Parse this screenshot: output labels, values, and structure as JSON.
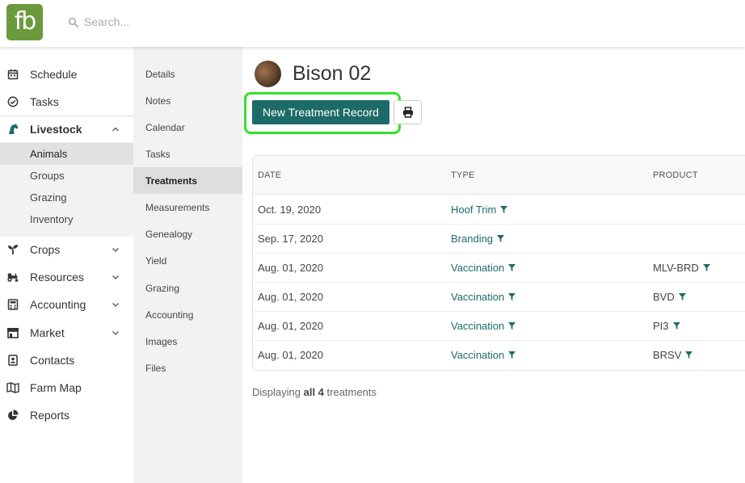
{
  "brand": {
    "logo_text": "fb",
    "color": "#6a9a3c"
  },
  "search": {
    "placeholder": "Search..."
  },
  "sidebar": {
    "items": [
      {
        "label": "Schedule",
        "icon": "calendar-icon"
      },
      {
        "label": "Tasks",
        "icon": "check-circle-icon"
      },
      {
        "label": "Livestock",
        "icon": "horse-icon",
        "expanded": true
      },
      {
        "label": "Crops",
        "icon": "seedling-icon"
      },
      {
        "label": "Resources",
        "icon": "tractor-icon"
      },
      {
        "label": "Accounting",
        "icon": "calculator-icon"
      },
      {
        "label": "Market",
        "icon": "store-icon"
      },
      {
        "label": "Contacts",
        "icon": "address-book-icon"
      },
      {
        "label": "Farm Map",
        "icon": "map-icon"
      },
      {
        "label": "Reports",
        "icon": "pie-chart-icon"
      }
    ],
    "livestock_sub": [
      "Animals",
      "Groups",
      "Grazing",
      "Inventory"
    ],
    "active_sub": "Animals"
  },
  "subnav": {
    "items": [
      "Details",
      "Notes",
      "Calendar",
      "Tasks",
      "Treatments",
      "Measurements",
      "Genealogy",
      "Yield",
      "Grazing",
      "Accounting",
      "Images",
      "Files"
    ],
    "active": "Treatments"
  },
  "animal": {
    "name": "Bison 02"
  },
  "actions": {
    "new_record_label": "New Treatment Record",
    "accent": "#1d6b68",
    "highlight": "#35e02a"
  },
  "table": {
    "columns": [
      "DATE",
      "TYPE",
      "PRODUCT"
    ],
    "rows": [
      {
        "date": "Oct. 19, 2020",
        "type": "Hoof Trim",
        "product": ""
      },
      {
        "date": "Sep. 17, 2020",
        "type": "Branding",
        "product": ""
      },
      {
        "date": "Aug. 01, 2020",
        "type": "Vaccination",
        "product": "MLV-BRD"
      },
      {
        "date": "Aug. 01, 2020",
        "type": "Vaccination",
        "product": "BVD"
      },
      {
        "date": "Aug. 01, 2020",
        "type": "Vaccination",
        "product": "PI3"
      },
      {
        "date": "Aug. 01, 2020",
        "type": "Vaccination",
        "product": "BRSV"
      }
    ]
  },
  "footer": {
    "prefix": "Displaying",
    "emphasis": "all 4",
    "suffix": "treatments"
  }
}
